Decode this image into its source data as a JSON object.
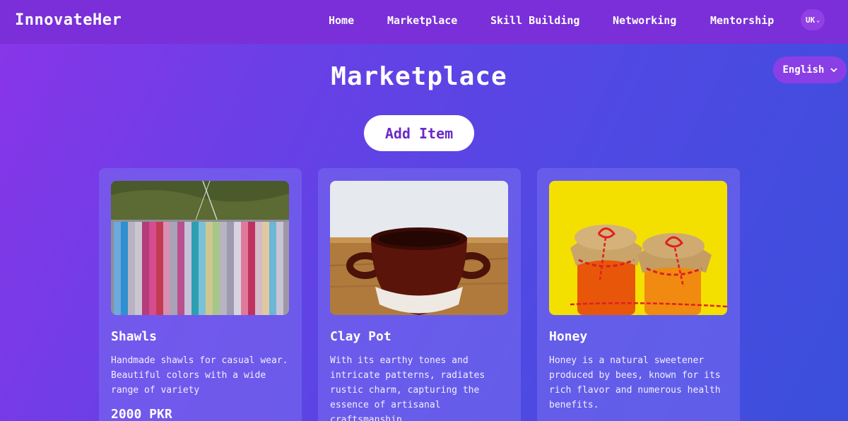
{
  "navbar": {
    "brand": "InnovateHer",
    "links": [
      {
        "label": "Home"
      },
      {
        "label": "Marketplace"
      },
      {
        "label": "Skill Building"
      },
      {
        "label": "Networking"
      },
      {
        "label": "Mentorship"
      }
    ],
    "language_code": "UK"
  },
  "language_selector": {
    "selected": "English"
  },
  "main": {
    "title": "Marketplace",
    "add_item_label": "Add Item"
  },
  "cards": [
    {
      "title": "Shawls",
      "description": "Handmade shawls for casual wear. Beautiful colors with a wide range of variety",
      "price": "2000 PKR"
    },
    {
      "title": "Clay Pot",
      "description": "With its earthy tones and intricate patterns, radiates rustic charm, capturing the essence of artisanal craftsmanship",
      "price": ""
    },
    {
      "title": "Honey",
      "description": "Honey is a natural sweetener produced by bees, known for its rich flavor and numerous health benefits.",
      "price": ""
    }
  ],
  "colors": {
    "navbar": "#7a2fd8",
    "accent": "#6a2ac8",
    "card": "#786ef0"
  }
}
